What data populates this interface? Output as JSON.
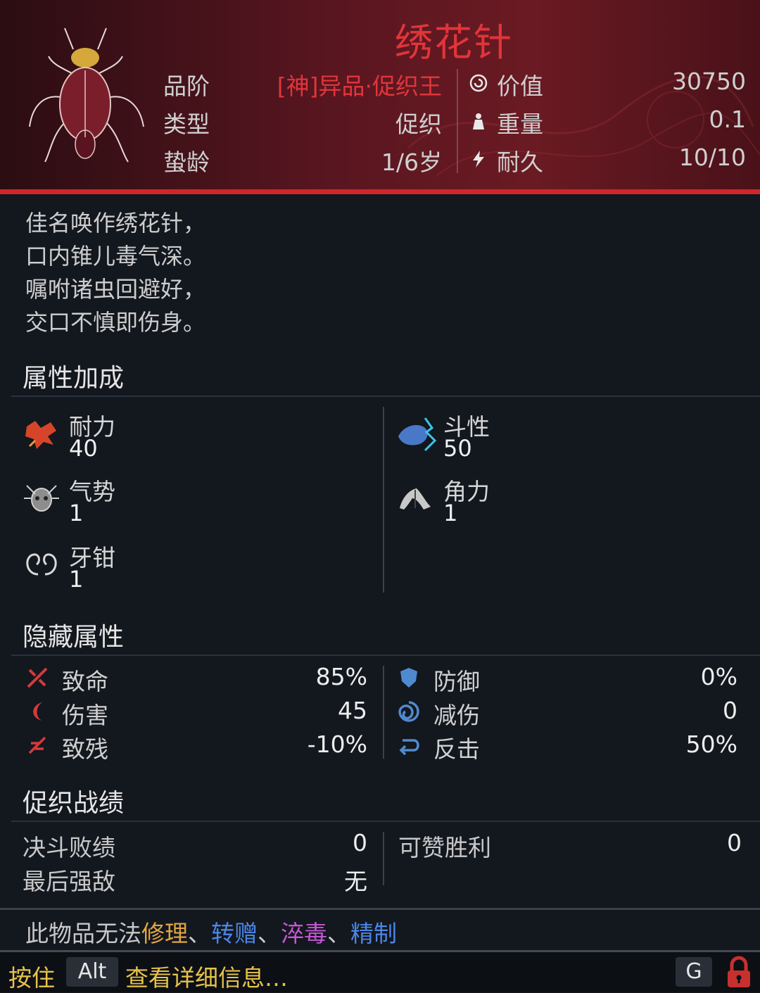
{
  "item": {
    "name": "绣花针",
    "rank_label": "品阶",
    "rank_value": "[神]异品·促织王",
    "type_label": "类型",
    "type_value": "促织",
    "age_label": "蛰龄",
    "age_value": "1/6岁",
    "price_label": "价值",
    "price_value": "30750",
    "weight_label": "重量",
    "weight_value": "0.1",
    "durability_label": "耐久",
    "durability_value": "10/10"
  },
  "poem": [
    "佳名唤作绣花针，",
    "口内锥儿毒气深。",
    "嘱咐诸虫回避好，",
    "交口不慎即伤身。"
  ],
  "attributes": {
    "title": "属性加成",
    "left": [
      {
        "name": "耐力",
        "value": "40",
        "icon": "endurance-icon"
      },
      {
        "name": "气势",
        "value": "1",
        "icon": "momentum-icon"
      },
      {
        "name": "牙钳",
        "value": "1",
        "icon": "mandible-icon"
      }
    ],
    "right": [
      {
        "name": "斗性",
        "value": "50",
        "icon": "fighting-spirit-icon"
      },
      {
        "name": "角力",
        "value": "1",
        "icon": "wrestling-icon"
      }
    ]
  },
  "hidden": {
    "title": "隐藏属性",
    "left": [
      {
        "name": "致命",
        "value": "85%",
        "icon": "fatal-icon"
      },
      {
        "name": "伤害",
        "value": "45",
        "icon": "damage-icon"
      },
      {
        "name": "致残",
        "value": "-10%",
        "icon": "cripple-icon"
      }
    ],
    "right": [
      {
        "name": "防御",
        "value": "0%",
        "icon": "shield-icon"
      },
      {
        "name": "减伤",
        "value": "0",
        "icon": "swirl-icon"
      },
      {
        "name": "反击",
        "value": "50%",
        "icon": "counter-icon"
      }
    ]
  },
  "record": {
    "title": "促织战绩",
    "duel_losses_label": "决斗败绩",
    "duel_losses_value": "0",
    "last_rival_label": "最后强敌",
    "last_rival_value": "无",
    "praise_wins_label": "可赞胜利",
    "praise_wins_value": "0"
  },
  "notice": {
    "prefix": "此物品无法",
    "repair": "修理",
    "sep1": "、",
    "gift": "转赠",
    "sep2": "、",
    "poison": "淬毒",
    "sep3": "、",
    "refine": "精制"
  },
  "footer": {
    "hold": "按住",
    "alt_key": "Alt",
    "detail": "查看详细信息…",
    "g_key": "G"
  },
  "colors": {
    "title_red": "#e1353a",
    "repair": "#e0a640",
    "gift": "#4c86e6",
    "poison": "#c657d8",
    "refine": "#4c86e6",
    "hint": "#e6c24a"
  }
}
